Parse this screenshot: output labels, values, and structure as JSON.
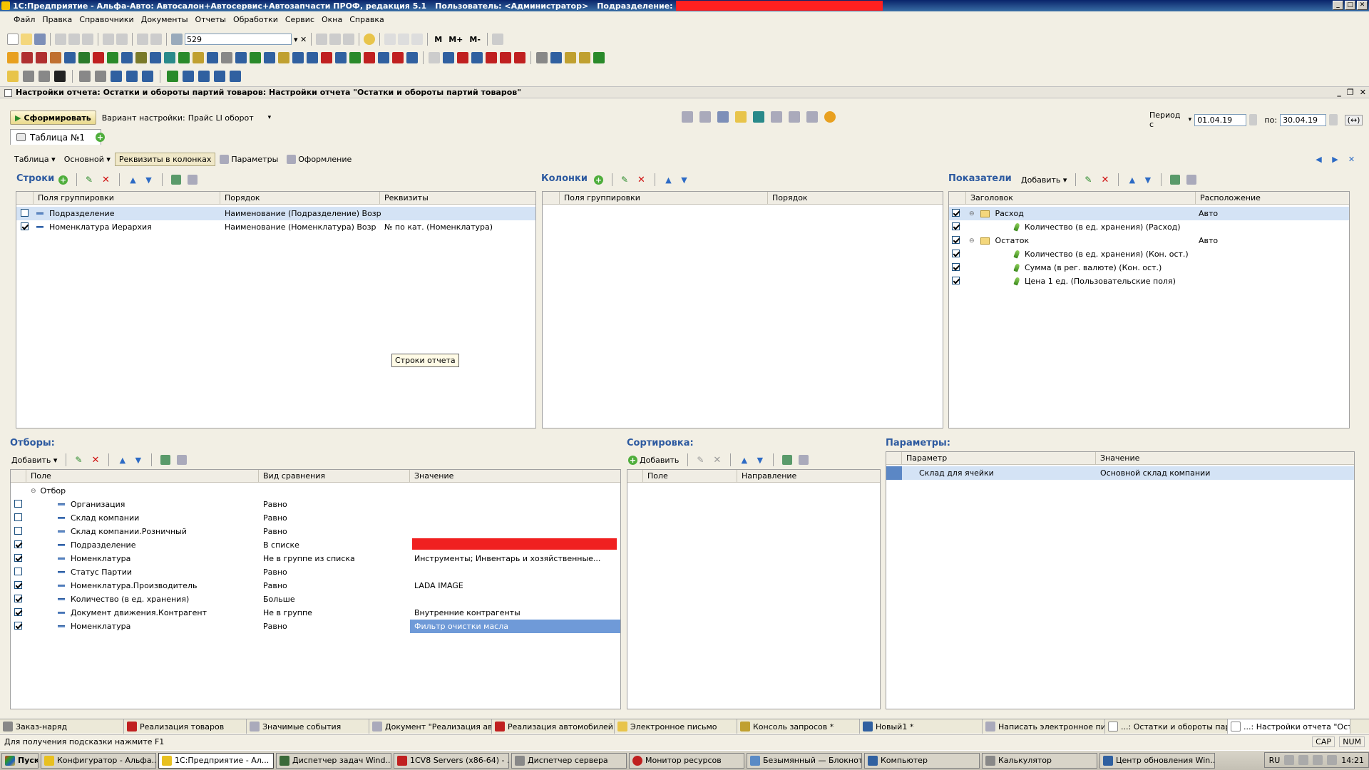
{
  "window": {
    "title": "1С:Предприятие - Альфа-Авто: Автосалон+Автосервис+Автозапчасти ПРОФ, редакция 5.1",
    "user_label": "Пользователь: <Администратор>",
    "division_label": "Подразделение:"
  },
  "menu": [
    "Файл",
    "Правка",
    "Справочники",
    "Документы",
    "Отчеты",
    "Обработки",
    "Сервис",
    "Окна",
    "Справка"
  ],
  "toolbar": {
    "search_value": "529",
    "m_labels": [
      "M",
      "M+",
      "M-"
    ]
  },
  "document": {
    "title": "Настройки отчета: Остатки и обороты партий товаров: Настройки отчета \"Остатки и обороты партий товаров\""
  },
  "report": {
    "generate_label": "Сформировать",
    "variant_label": "Вариант настройки:",
    "variant_value": "Прайс LI оборот",
    "period_label": "Период с",
    "date_from": "01.04.19",
    "to_label": "по:",
    "date_to": "30.04.19",
    "tab": "Таблица №1",
    "subtabs": [
      "Таблица",
      "Основной",
      "Реквизиты в колонках",
      "Параметры",
      "Оформление"
    ]
  },
  "rows_section": {
    "title": "Строки",
    "columns": [
      "Поля группировки",
      "Порядок",
      "Реквизиты"
    ],
    "items": [
      {
        "field": "Подразделение",
        "order": "Наименование (Подразделение) Возр",
        "attrs": "",
        "checked": false
      },
      {
        "field": "Номенклатура Иерархия",
        "order": "Наименование (Номенклатура) Возр",
        "attrs": "№ по кат. (Номенклатура)",
        "checked": true
      }
    ],
    "tooltip": "Строки отчета"
  },
  "columns_section": {
    "title": "Колонки",
    "columns": [
      "Поля группировки",
      "Порядок"
    ]
  },
  "indicators_section": {
    "title": "Показатели",
    "add_label": "Добавить",
    "columns": [
      "Заголовок",
      "Расположение"
    ],
    "items": [
      {
        "title": "Расход",
        "placement": "Авто",
        "level": 0
      },
      {
        "title": "Количество (в ед. хранения) (Расход)",
        "placement": "",
        "level": 1
      },
      {
        "title": "Остаток",
        "placement": "Авто",
        "level": 0
      },
      {
        "title": "Количество (в ед. хранения) (Кон. ост.)",
        "placement": "",
        "level": 1
      },
      {
        "title": "Сумма (в рег. валюте) (Кон. ост.)",
        "placement": "",
        "level": 1
      },
      {
        "title": "Цена 1 ед. (Пользовательские поля)",
        "placement": "",
        "level": 1
      }
    ]
  },
  "filters_section": {
    "title": "Отборы:",
    "add_label": "Добавить",
    "columns": [
      "Поле",
      "Вид сравнения",
      "Значение"
    ],
    "group": "Отбор",
    "items": [
      {
        "field": "Организация",
        "cmp": "Равно",
        "value": "",
        "checked": false
      },
      {
        "field": "Склад компании",
        "cmp": "Равно",
        "value": "",
        "checked": false
      },
      {
        "field": "Склад компании.Розничный",
        "cmp": "Равно",
        "value": "",
        "checked": false
      },
      {
        "field": "Подразделение",
        "cmp": "В списке",
        "value": "",
        "checked": true
      },
      {
        "field": "Номенклатура",
        "cmp": "Не в группе из списка",
        "value": "Инструменты; Инвентарь и хозяйственные...",
        "checked": true
      },
      {
        "field": "Статус Партии",
        "cmp": "Равно",
        "value": "",
        "checked": false
      },
      {
        "field": "Номенклатура.Производитель",
        "cmp": "Равно",
        "value": "LADA IMAGE",
        "checked": true
      },
      {
        "field": "Количество (в ед. хранения)",
        "cmp": "Больше",
        "value": "",
        "checked": true
      },
      {
        "field": "Документ движения.Контрагент",
        "cmp": "Не в группе",
        "value": "Внутренние контрагенты",
        "checked": true
      },
      {
        "field": "Номенклатура",
        "cmp": "Равно",
        "value": "Фильтр очистки масла",
        "checked": true
      }
    ]
  },
  "sort_section": {
    "title": "Сортировка:",
    "add_label": "Добавить",
    "columns": [
      "Поле",
      "Направление"
    ]
  },
  "params_section": {
    "title": "Параметры:",
    "columns": [
      "Параметр",
      "Значение"
    ],
    "items": [
      {
        "param": "Склад для ячейки",
        "value": "Основной склад компании"
      }
    ]
  },
  "window_tabs": [
    "Заказ-наряд",
    "Реализация товаров",
    "Значимые события",
    "Документ \"Реализация авт...",
    "Реализация автомобилей",
    "Электронное письмо",
    "Консоль запросов *",
    "Новый1 *",
    "Написать электронное пис...",
    "...: Остатки и обороты парт...",
    "...: Настройки отчета \"Оста..."
  ],
  "status": {
    "hint": "Для получения подсказки нажмите F1",
    "caps": "CAP",
    "num": "NUM"
  },
  "taskbar": {
    "start": "Пуск",
    "items": [
      "Конфигуратор - Альфа...",
      "1С:Предприятие - Ал...",
      "Диспетчер задач Wind...",
      "1CV8 Servers (x86-64) - ...",
      "Диспетчер сервера",
      "Монитор ресурсов",
      "Безымянный — Блокнот",
      "Компьютер",
      "Калькулятор",
      "Центр обновления Win..."
    ],
    "lang": "RU",
    "time": "14:21"
  }
}
